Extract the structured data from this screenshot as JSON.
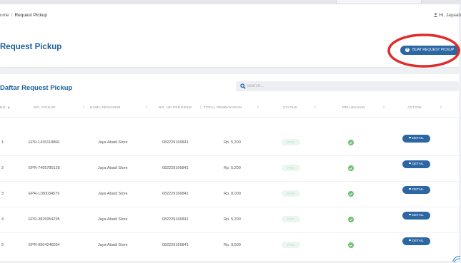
{
  "breadcrumb": {
    "home": "ome",
    "separator": "/",
    "current": "Request Pickup"
  },
  "user": {
    "greeting": "Hi, Jayaab",
    "icon": "user-icon"
  },
  "header": {
    "title": "Request Pickup",
    "new_button_label": "BUAT REQUEST PICKUP",
    "new_button_icon": "plus-circle-icon"
  },
  "list": {
    "title": "Daftar Request Pickup",
    "search_placeholder": "Search...",
    "columns": [
      "NO",
      "NO. PICKUP",
      "NAMA PENGIRIM",
      "NO. HP PENGIRIM",
      "TOTAL PEMBAYARAN",
      "STATUS",
      "PELUNASAN",
      "ACTION"
    ],
    "rows": [
      {
        "no": "1",
        "pickup": "EPR-1436118866",
        "sender": "Jaya Abadi Store",
        "phone": "082229166841",
        "total": "Rp. 5,200",
        "status": "PAID",
        "action": "DETAIL"
      },
      {
        "no": "2",
        "pickup": "EPR-7495780128",
        "sender": "Jaya Abadi Store",
        "phone": "082229166841",
        "total": "Rp. 5,200",
        "status": "PAID",
        "action": "DETAIL"
      },
      {
        "no": "3",
        "pickup": "EPR-1180034579",
        "sender": "Jaya Abadi Store",
        "phone": "082229166841",
        "total": "Rp. 8,000",
        "status": "PAID",
        "action": "DETAIL"
      },
      {
        "no": "4",
        "pickup": "EPR-3826954295",
        "sender": "Jaya Abadi Store",
        "phone": "082229166841",
        "total": "Rp. 5,200",
        "status": "PAID",
        "action": "DETAIL"
      },
      {
        "no": "5",
        "pickup": "EPR-9904246054",
        "sender": "Jaya Abadi Store",
        "phone": "082229166841",
        "total": "Rp. 9,500",
        "status": "PAID",
        "action": "DETAIL"
      }
    ]
  },
  "colors": {
    "brand": "#1d5f9d",
    "button": "#2d67a3",
    "success": "#6cc070",
    "annotation": "#e02b2b"
  }
}
